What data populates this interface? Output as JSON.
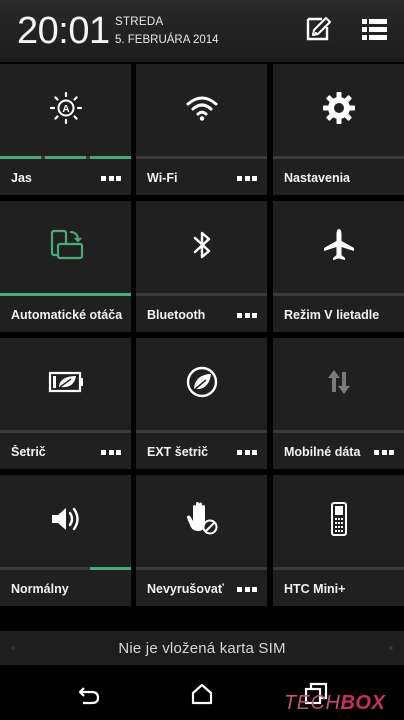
{
  "header": {
    "time": "20:01",
    "day": "STREDA",
    "date": "5. FEBRUÁRA 2014",
    "edit_icon": "edit-icon",
    "menu_icon": "list-menu-icon"
  },
  "tiles": [
    {
      "label": "Jas",
      "icon": "brightness-auto-icon",
      "has_more": true,
      "level_segments_lit": 3,
      "level_segments_total": 3
    },
    {
      "label": "Wi-Fi",
      "icon": "wifi-icon",
      "has_more": true,
      "active": false
    },
    {
      "label": "Nastavenia",
      "icon": "gear-icon",
      "has_more": false
    },
    {
      "label": "Automatické otáčanie",
      "icon": "auto-rotate-icon",
      "has_more": false,
      "active": true
    },
    {
      "label": "Bluetooth",
      "icon": "bluetooth-icon",
      "has_more": true,
      "active": false
    },
    {
      "label": "Režim V lietadle",
      "icon": "airplane-icon",
      "has_more": false,
      "active": false
    },
    {
      "label": "Šetrič",
      "icon": "battery-saver-icon",
      "has_more": true,
      "active": false
    },
    {
      "label": "EXT šetrič",
      "icon": "extreme-saver-icon",
      "has_more": true,
      "active": false
    },
    {
      "label": "Mobilné dáta",
      "icon": "mobile-data-icon",
      "has_more": true,
      "active": false
    },
    {
      "label": "Normálny",
      "icon": "volume-icon",
      "has_more": false,
      "active": true
    },
    {
      "label": "Nevyrušovať",
      "icon": "do-not-disturb-icon",
      "has_more": true,
      "active": false
    },
    {
      "label": "HTC Mini+",
      "icon": "htc-mini-icon",
      "has_more": false,
      "active": false
    }
  ],
  "status": {
    "sim_text": "Nie je vložená karta SIM"
  },
  "navbar": {
    "back_icon": "back-icon",
    "home_icon": "home-icon",
    "recents_icon": "recents-icon"
  },
  "watermark": {
    "part1": "TECH",
    "part2": "BOX"
  },
  "colors": {
    "accent": "#4da87b",
    "tile_bg": "#202020",
    "background": "#000000"
  }
}
